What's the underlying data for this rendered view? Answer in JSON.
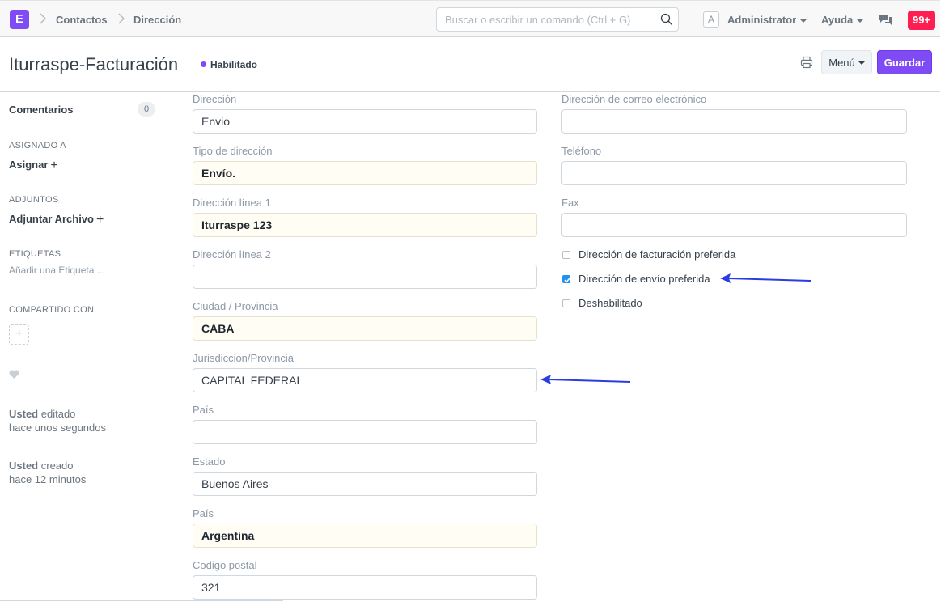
{
  "navbar": {
    "logo": "E",
    "breadcrumbs": [
      "Contactos",
      "Dirección"
    ],
    "search_placeholder": "Buscar o escribir un comando (Ctrl + G)",
    "avatar": "A",
    "user": "Administrator",
    "help": "Ayuda",
    "notifications": "99+"
  },
  "page": {
    "title": "Iturraspe-Facturación",
    "status": "Habilitado",
    "menu_label": "Menú",
    "save_label": "Guardar",
    "accent": "#7e4bf5"
  },
  "sidebar": {
    "comments_label": "Comentarios",
    "comments_count": "0",
    "assigned_header": "ASIGNADO A",
    "assign_label": "Asignar",
    "attachments_header": "ADJUNTOS",
    "attach_label": "Adjuntar Archivo",
    "tags_header": "ETIQUETAS",
    "tags_placeholder": "Añadir una Etiqueta ...",
    "shared_header": "COMPARTIDO CON",
    "activity": [
      {
        "who": "Usted",
        "action": "editado",
        "when": "hace unos segundos"
      },
      {
        "who": "Usted",
        "action": "creado",
        "when": "hace 12 minutos"
      }
    ]
  },
  "form": {
    "left": [
      {
        "label": "Dirección",
        "value": "Envio",
        "bold": false
      },
      {
        "label": "Tipo de dirección",
        "value": "Envío.",
        "bold": true
      },
      {
        "label": "Dirección línea 1",
        "value": "Iturraspe 123",
        "bold": true
      },
      {
        "label": "Dirección línea 2",
        "value": "",
        "bold": false
      },
      {
        "label": "Ciudad / Provincia",
        "value": "CABA",
        "bold": true
      },
      {
        "label": "Jurisdiccion/Provincia",
        "value": "CAPITAL FEDERAL",
        "bold": false
      },
      {
        "label": "País",
        "value": "",
        "bold": false
      },
      {
        "label": "Estado",
        "value": "Buenos Aires",
        "bold": false
      },
      {
        "label": "País",
        "value": "Argentina",
        "bold": true
      },
      {
        "label": "Codigo postal",
        "value": "321",
        "bold": false
      }
    ],
    "right": [
      {
        "label": "Dirección de correo electrónico",
        "value": ""
      },
      {
        "label": "Teléfono",
        "value": ""
      },
      {
        "label": "Fax",
        "value": ""
      }
    ],
    "checks": [
      {
        "label": "Dirección de facturación preferida",
        "checked": false
      },
      {
        "label": "Dirección de envío preferida",
        "checked": true
      },
      {
        "label": "Deshabilitado",
        "checked": false
      }
    ]
  }
}
